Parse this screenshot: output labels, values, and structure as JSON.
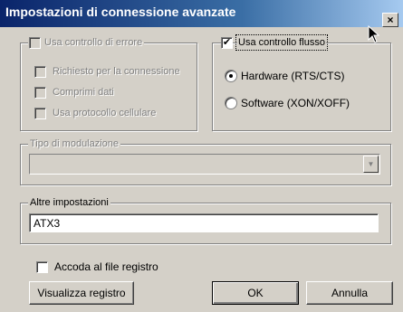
{
  "window": {
    "title": "Impostazioni di connessione avanzate",
    "close_label": "×"
  },
  "error_control": {
    "label": "Usa controllo di errore",
    "checked": false,
    "enabled": false,
    "options": [
      {
        "label": "Richiesto per la connessione",
        "checked": false
      },
      {
        "label": "Comprimi dati",
        "checked": false
      },
      {
        "label": "Usa protocollo cellulare",
        "checked": false
      }
    ]
  },
  "flow_control": {
    "label": "Usa controllo flusso",
    "checked": true,
    "options": [
      {
        "label": "Hardware (RTS/CTS)",
        "selected": true
      },
      {
        "label": "Software (XON/XOFF)",
        "selected": false
      }
    ]
  },
  "modulation": {
    "label": "Tipo di modulazione",
    "value": "",
    "enabled": false
  },
  "extra": {
    "label": "Altre impostazioni",
    "value": "ATX3"
  },
  "log": {
    "label": "Accoda al file registro",
    "checked": false
  },
  "buttons": {
    "view_log": "Visualizza registro",
    "ok": "OK",
    "cancel": "Annulla"
  }
}
